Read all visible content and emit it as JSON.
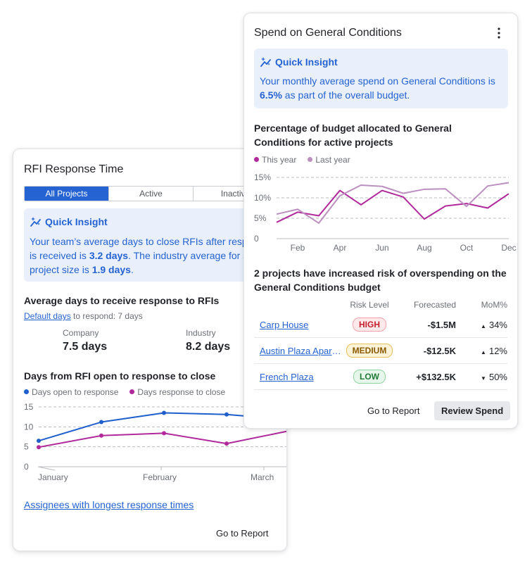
{
  "rfi": {
    "title": "RFI Response Time",
    "tabs": [
      "All Projects",
      "Active",
      "Inactive"
    ],
    "insight": {
      "heading": "Quick Insight",
      "text1": "Your team’s average days to close RFIs after response is received is ",
      "value1": "3.2 days",
      "text2": ". The industry average for similar project size is ",
      "value2": "1.9 days",
      "text3": "."
    },
    "avg_heading": "Average days to receive response to RFIs",
    "default_days_link": "Default days",
    "respond_text": " to respond: 7 days",
    "company_label": "Company",
    "company_value": "7.5 days",
    "industry_label": "Industry",
    "industry_value": "8.2 days",
    "chart_heading": "Days from RFI open to response to close",
    "legend": [
      "Days open to response",
      "Days response to close"
    ],
    "assignees_link": "Assignees with longest response times",
    "go_to_report": "Go to Report"
  },
  "spend": {
    "title": "Spend on General Conditions",
    "menu_icon": "more-vertical-icon",
    "insight": {
      "heading": "Quick Insight",
      "text1": "Your monthly average spend on General Conditions is ",
      "value1": "6.5%",
      "text2": " as part of the overall budget."
    },
    "chart_heading": "Percentage of budget allocated to General Conditions for active projects",
    "legend": [
      "This year",
      "Last year"
    ],
    "risk_heading": "2 projects have increased risk of overspending on the General Conditions budget",
    "table": {
      "headers": [
        "",
        "Risk Level",
        "Forecasted",
        "MoM%"
      ],
      "rows": [
        {
          "project": "Carp House",
          "risk": "HIGH",
          "forecast": "-$1.5M",
          "mom": "34%",
          "dir": "up"
        },
        {
          "project": "Austin Plaza Apartments",
          "risk": "MEDIUM",
          "forecast": "-$12.5K",
          "mom": "12%",
          "dir": "up"
        },
        {
          "project": "French Plaza",
          "risk": "LOW",
          "forecast": "+$132.5K",
          "mom": "50%",
          "dir": "down"
        }
      ]
    },
    "go_to_report": "Go to Report",
    "review_spend": "Review Spend"
  },
  "colors": {
    "accent": "#2463d1",
    "series_blue": "#1f5fcc",
    "series_magenta": "#b02a9c",
    "series_lilac": "#bb8fbf",
    "insight_bg": "#e9f0fb"
  },
  "chart_data": [
    {
      "type": "line",
      "title": "Days from RFI open to response to close",
      "x": [
        "January",
        "",
        "",
        "February",
        "",
        "March"
      ],
      "ylim": [
        0,
        15
      ],
      "yticks": [
        0,
        5,
        10,
        15
      ],
      "series": [
        {
          "name": "Days open to response",
          "values": [
            6.5,
            11.2,
            13.5,
            13.1,
            11.8
          ]
        },
        {
          "name": "Days response to close",
          "values": [
            4.9,
            7.8,
            8.4,
            5.8,
            9.0
          ]
        }
      ],
      "legend": "top-left",
      "grid": true
    },
    {
      "type": "line",
      "title": "Percentage of budget allocated to General Conditions for active projects",
      "x": [
        "Jan",
        "Feb",
        "Mar",
        "Apr",
        "May",
        "Jun",
        "Jul",
        "Aug",
        "Sep",
        "Oct",
        "Nov",
        "Dec"
      ],
      "xtick_labels": [
        "Feb",
        "Apr",
        "Jun",
        "Aug",
        "Oct",
        "Dec"
      ],
      "ylim": [
        0,
        15
      ],
      "yticks": [
        "0",
        "5%",
        "10%",
        "15%"
      ],
      "series": [
        {
          "name": "This year",
          "values": [
            4.0,
            6.5,
            5.6,
            11.8,
            8.3,
            11.8,
            10.2,
            4.8,
            8.0,
            8.6,
            7.5,
            11.0
          ]
        },
        {
          "name": "Last year",
          "values": [
            6.0,
            7.2,
            3.8,
            10.5,
            13.1,
            12.8,
            11.1,
            12.1,
            12.2,
            7.9,
            12.9,
            13.7
          ]
        }
      ],
      "legend": "top-left",
      "grid": true
    }
  ]
}
